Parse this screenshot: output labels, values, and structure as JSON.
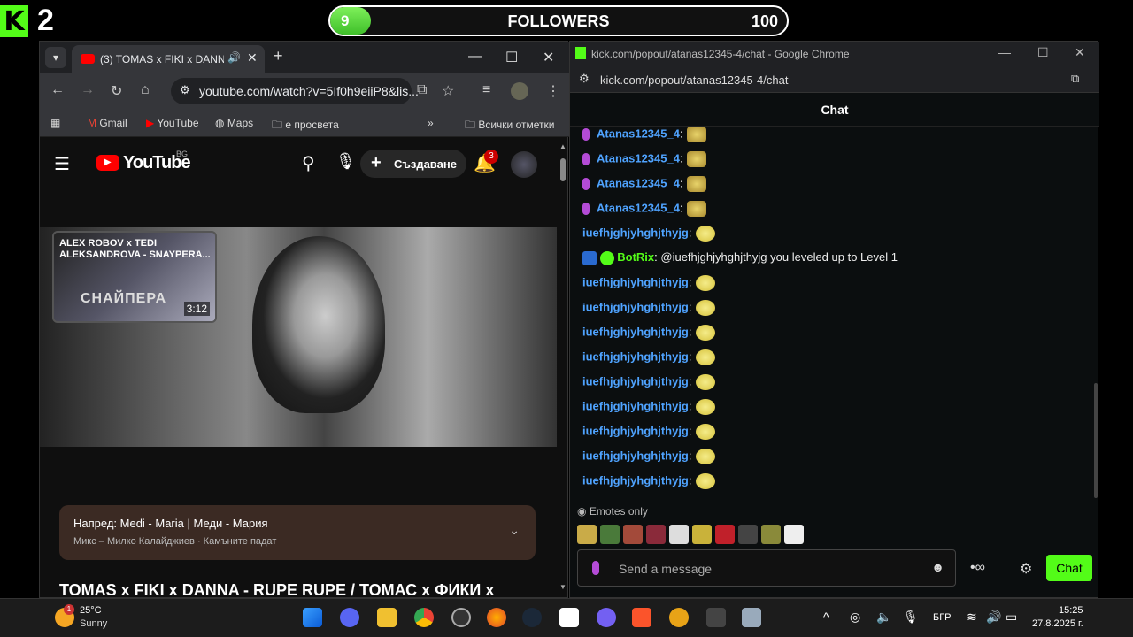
{
  "overlay": {
    "kick_logo": "K",
    "kick_count": "2",
    "followers_current": "9",
    "followers_label": "FOLLOWERS",
    "followers_goal": "100",
    "followers_progress": 0.09
  },
  "youtube_window": {
    "tab_title": "(3) TOMAS x FIKI x DANNA",
    "new_tab": "+",
    "url": "youtube.com/watch?v=5If0h9eiiP8&lis...",
    "bookmarks": [
      "Gmail",
      "YouTube",
      "Maps",
      "е просвета",
      "»",
      "Всички отметки"
    ],
    "yt_logo_text": "YouTube",
    "yt_region": "BG",
    "create_label": "Създаване",
    "notifications": "3",
    "endcard_title": "ALEX ROBOV x TEDI ALEKSANDROVA - SNAYPERA...",
    "endcard_duration": "3:12",
    "endcard_art": "СНАЙПЕРА",
    "up_next_title": "Напред: Medi - Maria | Меди - Мария",
    "up_next_sub": "Микс – Милко Калайджиев · Камъните падат",
    "video_title": "TOMAS x FIKI x DANNA - RUPE RUPE / ТОМАС x ФИКИ x"
  },
  "chat_window": {
    "window_title": "kick.com/popout/atanas12345-4/chat - Google Chrome",
    "url": "kick.com/popout/atanas12345-4/chat",
    "header": "Chat",
    "messages": [
      {
        "user": "Atanas12345_4",
        "type": "mic"
      },
      {
        "user": "Atanas12345_4",
        "type": "mic"
      },
      {
        "user": "Atanas12345_4",
        "type": "mic"
      },
      {
        "user": "Atanas12345_4",
        "type": "mic"
      },
      {
        "user": "iuefhjghjyhghjthyjg",
        "type": "plain"
      },
      {
        "user": "BotRix",
        "text": "@iuefhjghjyhghjthyjg you leveled up to Level 1",
        "type": "bot"
      },
      {
        "user": "iuefhjghjyhghjthyjg",
        "type": "plain"
      },
      {
        "user": "iuefhjghjyhghjthyjg",
        "type": "plain"
      },
      {
        "user": "iuefhjghjyhghjthyjg",
        "type": "plain"
      },
      {
        "user": "iuefhjghjyhghjthyjg",
        "type": "plain"
      },
      {
        "user": "iuefhjghjyhghjthyjg",
        "type": "plain"
      },
      {
        "user": "iuefhjghjyhghjthyjg",
        "type": "plain"
      },
      {
        "user": "iuefhjghjyhghjthyjg",
        "type": "plain"
      },
      {
        "user": "iuefhjghjyhghjthyjg",
        "type": "plain"
      },
      {
        "user": "iuefhjghjyhghjthyjg",
        "type": "plain"
      }
    ],
    "emotes_only": "Emotes only",
    "input_placeholder": "Send a message",
    "send_label": "Chat"
  },
  "taskbar": {
    "weather_temp": "25°C",
    "weather_desc": "Sunny",
    "weather_badge": "1",
    "language": "БГР",
    "time": "15:25",
    "date": "27.8.2025 г."
  },
  "colors": {
    "kick_green": "#53fc18",
    "yt_red": "#ff0000",
    "chat_user": "#4fa3ff"
  }
}
